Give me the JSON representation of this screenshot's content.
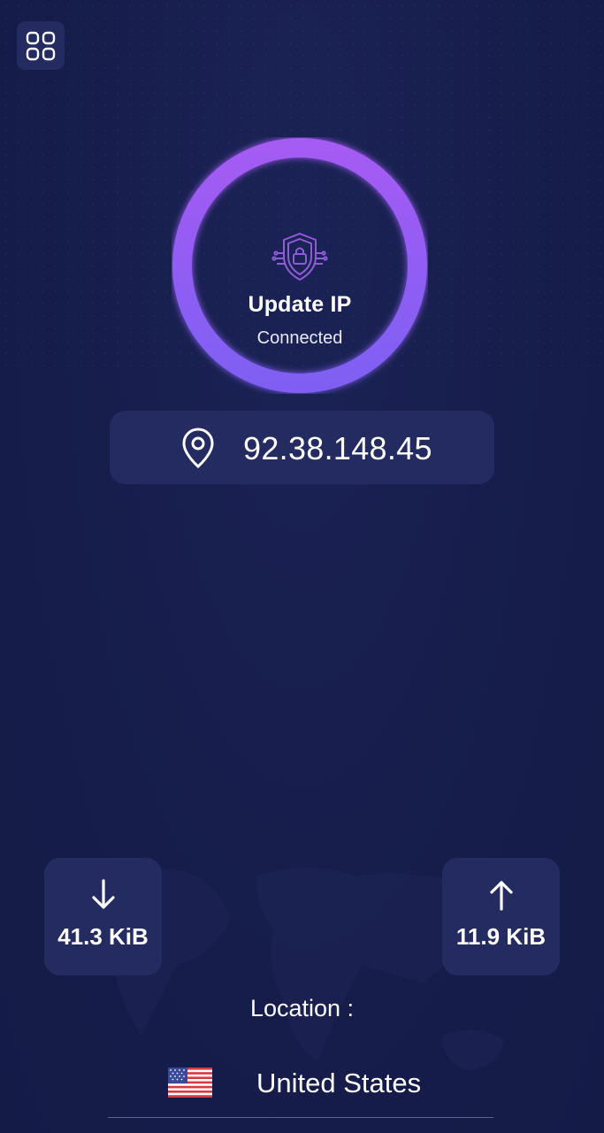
{
  "header": {
    "menu_icon": "grid-icon"
  },
  "status": {
    "title": "Update IP",
    "state": "Connected",
    "icon": "shield-lock-icon",
    "ring_color": "#8b5cf6"
  },
  "ip": {
    "icon": "location-pin-icon",
    "address": "92.38.148.45"
  },
  "traffic": {
    "download": {
      "icon": "arrow-down-icon",
      "value": "41.3 KiB"
    },
    "upload": {
      "icon": "arrow-up-icon",
      "value": "11.9 KiB"
    }
  },
  "location": {
    "label": "Location :",
    "country": "United States",
    "flag_icon": "us-flag-icon"
  },
  "colors": {
    "background": "#161d4a",
    "card": "#242b61",
    "accent": "#9b5cf6"
  }
}
